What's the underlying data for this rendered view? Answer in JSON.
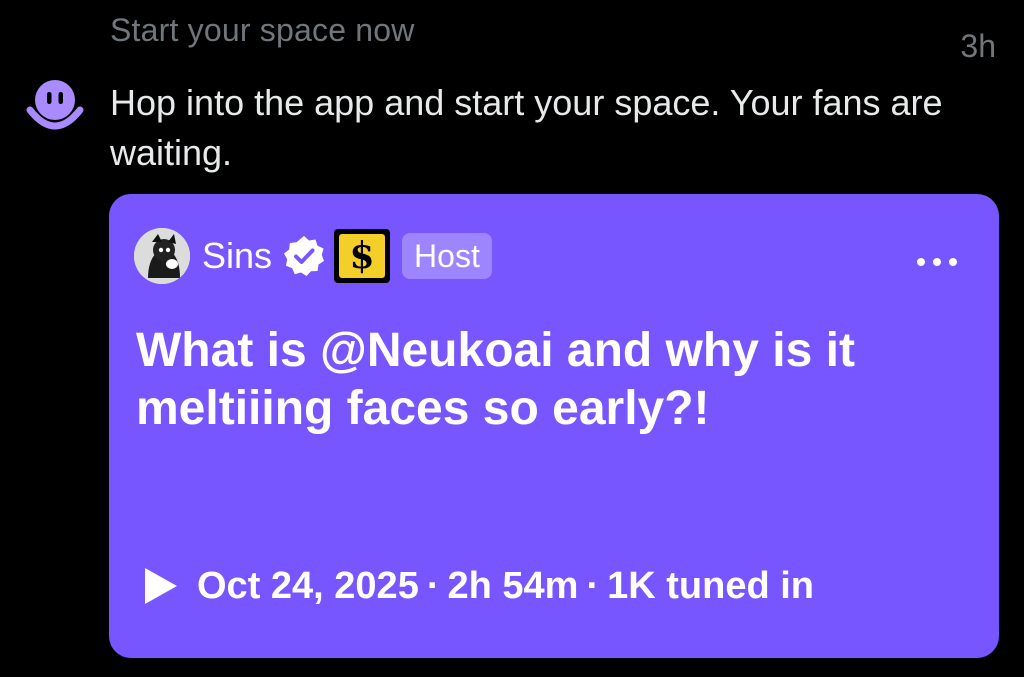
{
  "notification": {
    "label": "Start your space now",
    "time": "3h",
    "message": "Hop into the app and start your space. Your fans are waiting.",
    "icon": "spaces-smiley-icon",
    "accent_color": "#7856ff"
  },
  "card": {
    "host": {
      "name": "Sins",
      "verified_icon": "verified-badge-icon",
      "affiliate_icon": "affiliate-s-logo",
      "affiliate_letter": "$",
      "role_label": "Host"
    },
    "more_icon": "more-dots-icon",
    "title": "What is @Neukoai and why is it meltiiing faces so early?!",
    "meta": {
      "play_icon": "play-icon",
      "date": "Oct 24, 2025",
      "separator": "·",
      "duration": "2h 54m",
      "listeners": "1K tuned in"
    },
    "background_color": "#7856ff"
  }
}
